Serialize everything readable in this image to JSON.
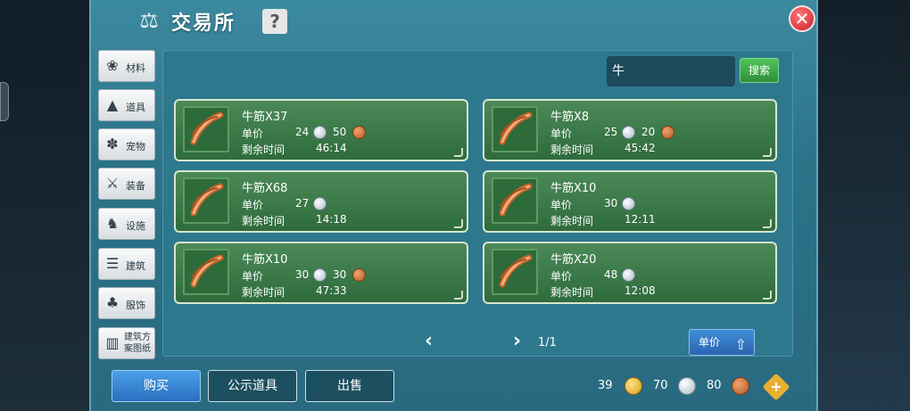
{
  "header": {
    "title": "交易所",
    "help_label": "?",
    "close_label": "✕"
  },
  "sidebar": {
    "items": [
      {
        "label": "材料",
        "icon": "materials-icon"
      },
      {
        "label": "道具",
        "icon": "props-icon"
      },
      {
        "label": "宠物",
        "icon": "pet-paw-icon"
      },
      {
        "label": "装备",
        "icon": "equipment-icon"
      },
      {
        "label": "设施",
        "icon": "facility-icon"
      },
      {
        "label": "建筑",
        "icon": "building-icon"
      },
      {
        "label": "服饰",
        "icon": "clothing-icon"
      },
      {
        "label": "建筑方案图纸",
        "icon": "blueprint-icon"
      }
    ]
  },
  "search": {
    "value": "牛",
    "button_label": "搜索"
  },
  "labels": {
    "unit_price": "单价",
    "remaining_time": "剩余时间"
  },
  "listings": [
    {
      "name": "牛筋X37",
      "silver": "24",
      "copper": "50",
      "time": "46:14"
    },
    {
      "name": "牛筋X8",
      "silver": "25",
      "copper": "20",
      "time": "45:42"
    },
    {
      "name": "牛筋X68",
      "silver": "27",
      "copper": "",
      "time": "14:18"
    },
    {
      "name": "牛筋X10",
      "silver": "30",
      "copper": "",
      "time": "12:11"
    },
    {
      "name": "牛筋X10",
      "silver": "30",
      "copper": "30",
      "time": "47:33"
    },
    {
      "name": "牛筋X20",
      "silver": "48",
      "copper": "",
      "time": "12:08"
    }
  ],
  "pagination": {
    "page": "1/1",
    "prev": "‹",
    "next": "›"
  },
  "sort": {
    "label": "单价",
    "arrow": "⇧"
  },
  "footer": {
    "buy_label": "购买",
    "public_label": "公示道具",
    "sell_label": "出售"
  },
  "currency": {
    "gold": "39",
    "silver": "70",
    "copper": "80",
    "add_label": "+"
  },
  "colors": {
    "card_green": "#2f6b3c",
    "panel_teal": "#2e788e",
    "search_green": "#3aa846",
    "buy_blue": "#3a86d6",
    "close_red": "#d0283a"
  }
}
